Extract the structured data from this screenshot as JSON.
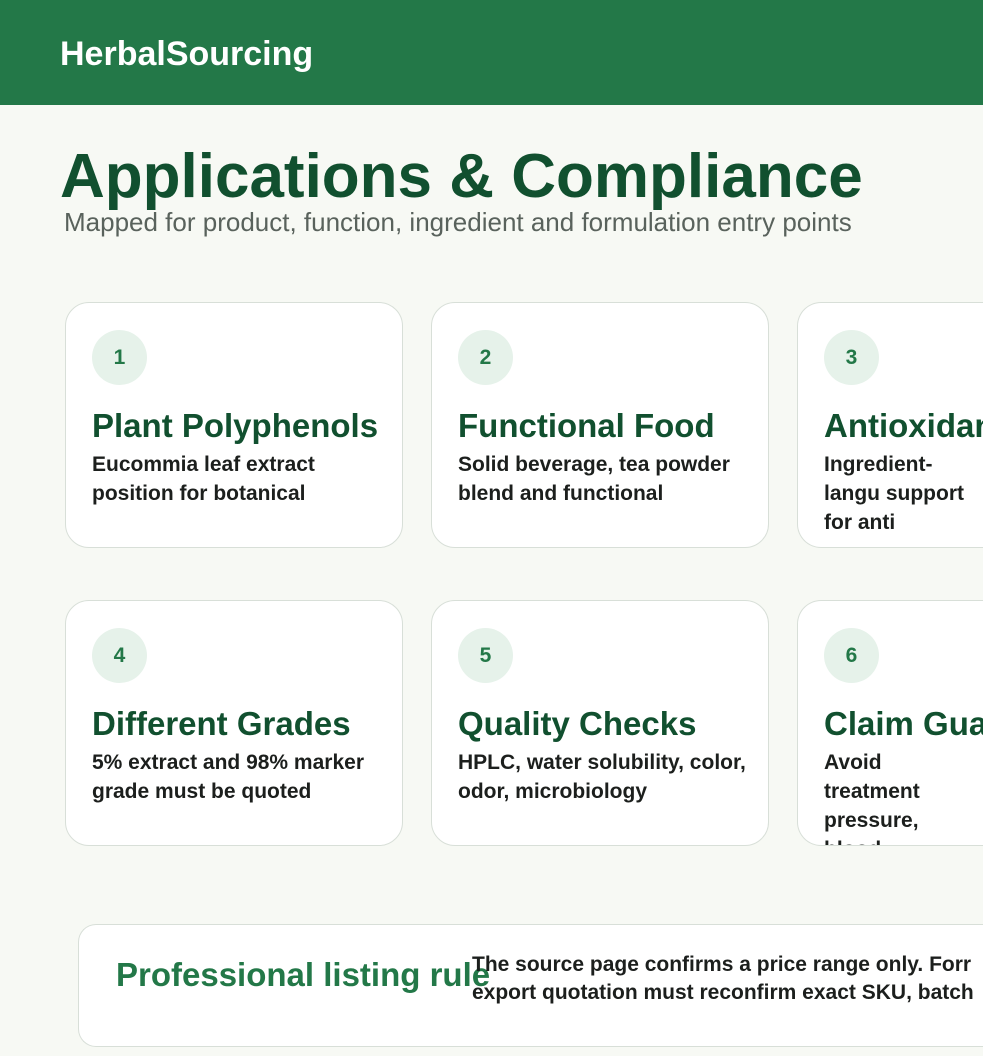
{
  "header": {
    "brand": "HerbalSourcing"
  },
  "page": {
    "title": "Applications & Compliance",
    "subtitle": "Mapped for product, function, ingredient and formulation entry points"
  },
  "cards": [
    {
      "number": "1",
      "title": "Plant Polyphenols",
      "description": "Eucommia leaf extract position for botanical"
    },
    {
      "number": "2",
      "title": "Functional Food",
      "description": "Solid beverage, tea powder blend and functional"
    },
    {
      "number": "3",
      "title": "Antioxidan",
      "description": "Ingredient-langu support for anti"
    },
    {
      "number": "4",
      "title": "Different Grades",
      "description": "5% extract and 98% marker grade must be quoted"
    },
    {
      "number": "5",
      "title": "Quality Checks",
      "description": "HPLC, water solubility, color, odor, microbiology"
    },
    {
      "number": "6",
      "title": "Claim Gua",
      "description": "Avoid treatment pressure, blood"
    }
  ],
  "rule": {
    "title": "Professional listing rule",
    "text": "The source page confirms a price range only. Forr export quotation must reconfirm exact SKU, batch"
  }
}
